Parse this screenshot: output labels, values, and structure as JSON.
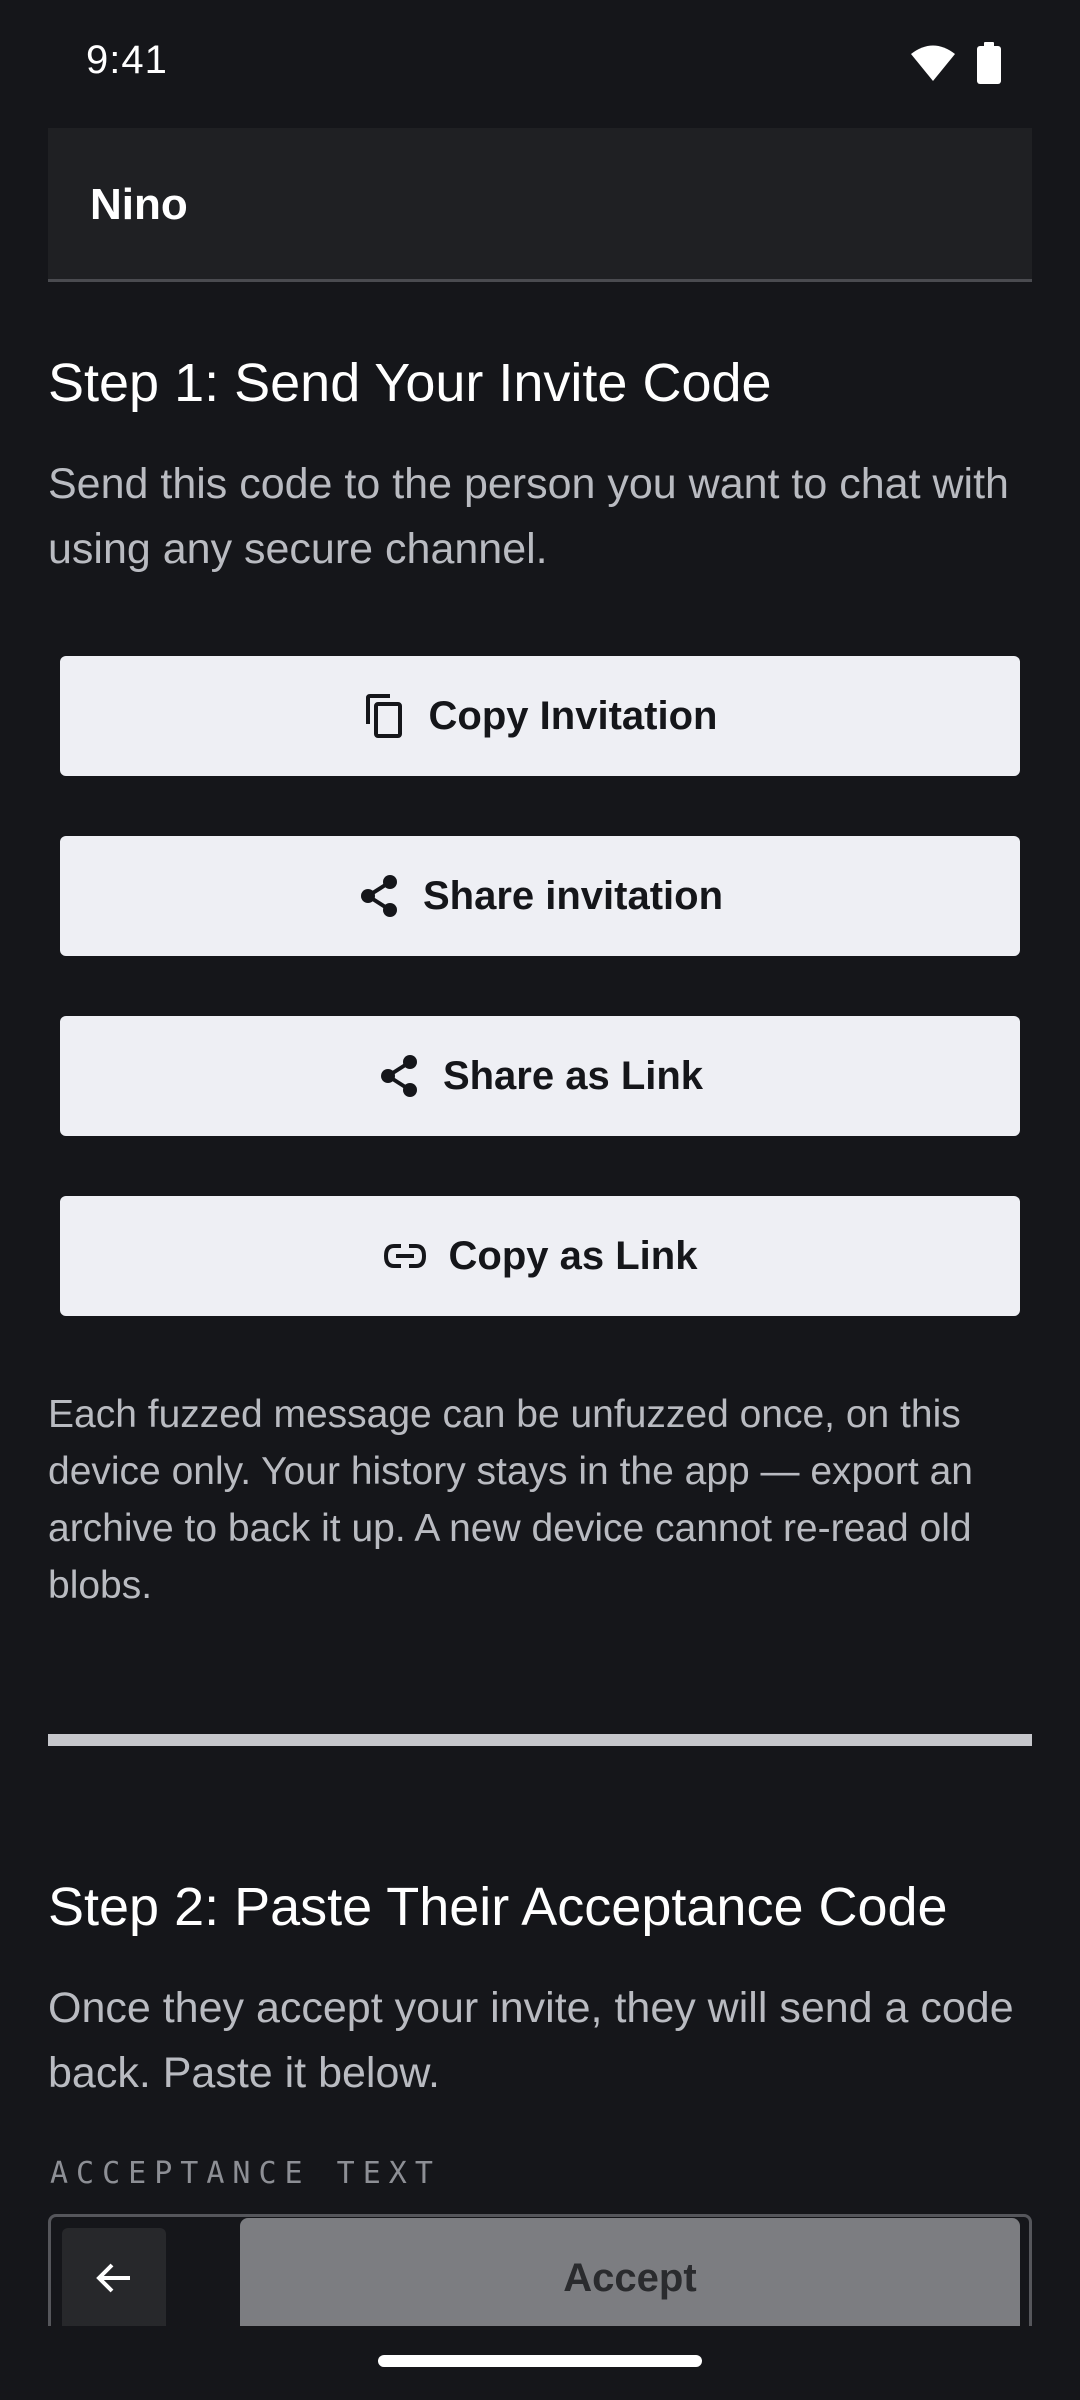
{
  "status_bar": {
    "time": "9:41",
    "icons": [
      "wifi-icon",
      "battery-icon"
    ]
  },
  "name_field": {
    "value": "Nino"
  },
  "step1": {
    "title": "Step 1: Send Your Invite Code",
    "description": "Send this code to the person you want to chat with using any secure channel.",
    "buttons": [
      {
        "label": "Copy Invitation",
        "icon": "copy-icon"
      },
      {
        "label": "Share invitation",
        "icon": "share-icon"
      },
      {
        "label": "Share as Link",
        "icon": "share-icon"
      },
      {
        "label": "Copy as Link",
        "icon": "link-icon"
      }
    ],
    "note": "Each fuzzed message can be unfuzzed once, on this device only. Your history stays in the app — export an archive to back it up. A new device cannot re-read old blobs."
  },
  "step2": {
    "title": "Step 2: Paste Their Acceptance Code",
    "description": "Once they accept your invite, they will send a code back. Paste it below.",
    "field_label": "ACCEPTANCE TEXT",
    "accept_label": "Accept",
    "back_icon": "arrow-left-icon"
  },
  "colors": {
    "background": "#15161a",
    "button_bg": "#eeeff4",
    "accept_disabled": "#7c7d81",
    "secondary_text": "#b9bbc1"
  }
}
